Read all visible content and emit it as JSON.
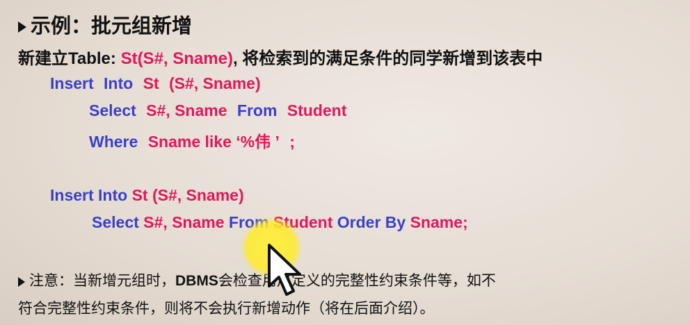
{
  "title": "示例：批元组新增",
  "subtitle": {
    "prefix": "新建立Table: ",
    "table": "St(S#, Sname)",
    "suffix": ", 将检索到的满足条件的同学新增到该表中"
  },
  "example1": {
    "line1": {
      "kw1": "Insert",
      "kw2": "Into",
      "table": "St",
      "cols": "(S#, Sname)"
    },
    "line2": {
      "kw1": "Select",
      "cols": "S#, Sname",
      "kw2": "From",
      "table": "Student"
    },
    "line3": {
      "kw1": "Where",
      "cond": "Sname like ‘%伟 ’",
      "end": ";"
    }
  },
  "example2": {
    "line1": {
      "kw": "Insert Into",
      "rest": "St (S#, Sname)"
    },
    "line2": {
      "kw1": "Select",
      "cols": "S#, Sname",
      "kw2": "From",
      "table": "Student",
      "kw3": "Order By",
      "col": "Sname;"
    }
  },
  "note": {
    "part1": "注意：当新增元组时，",
    "dbms": "DBMS",
    "part2": "会检查用户定义的完整性约束条件等，如不",
    "line2": "符合完整性约束条件，则将不会执行新增动作（将在后面介绍）。"
  },
  "colors": {
    "keyword": "#3b3fc8",
    "identifier": "#e0185a",
    "highlight": "#ffeb28"
  },
  "icons": [
    "bullet-arrow-icon",
    "mouse-pointer-icon"
  ]
}
